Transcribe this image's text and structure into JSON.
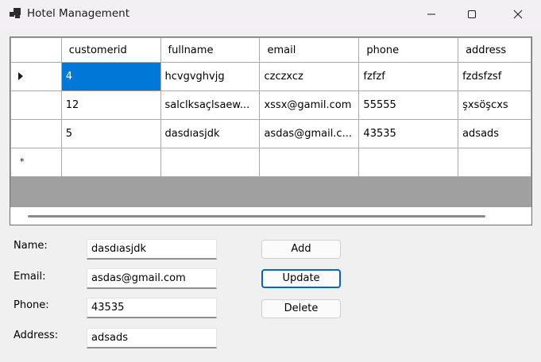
{
  "window": {
    "title": "Hotel Management",
    "icon": "app-window-icon"
  },
  "grid": {
    "columns": [
      "customerid",
      "fullname",
      "email",
      "phone",
      "address"
    ],
    "rows": [
      {
        "customerid": "4",
        "fullname": "hcvgvghvjg",
        "email": "czczxcz",
        "phone": "fzfzf",
        "address": "fzdsfzsf"
      },
      {
        "customerid": "12",
        "fullname": "salclksaçlsaew...",
        "email": "xssx@gamil.com",
        "phone": "55555",
        "address": "şxsöşcxs"
      },
      {
        "customerid": "5",
        "fullname": "dasdıasjdk",
        "email": "asdas@gmail.c...",
        "phone": "43535",
        "address": "adsads"
      }
    ],
    "new_row_marker": "*",
    "selected_cell_color": "#0078d7"
  },
  "form": {
    "name_label": "Name:",
    "email_label": "Email:",
    "phone_label": "Phone:",
    "address_label": "Address:",
    "name_value": "dasdıasjdk",
    "email_value": "asdas@gmail.com",
    "phone_value": "43535",
    "address_value": "adsads"
  },
  "buttons": {
    "add": "Add",
    "update": "Update",
    "delete": "Delete"
  }
}
